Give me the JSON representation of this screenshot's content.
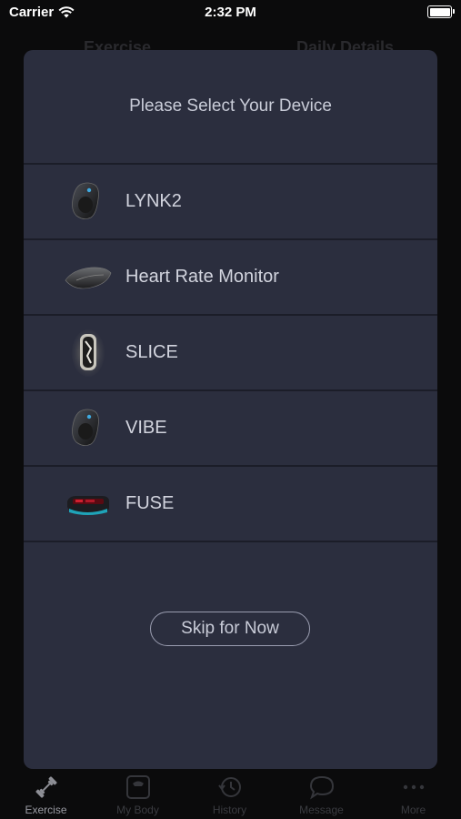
{
  "status_bar": {
    "carrier": "Carrier",
    "time": "2:32 PM"
  },
  "background_header": {
    "left_tab": "Exercise",
    "right_tab": "Daily Details"
  },
  "modal": {
    "title": "Please Select Your Device",
    "devices": [
      {
        "label": "LYNK2",
        "icon": "lynk2-device-icon"
      },
      {
        "label": "Heart Rate Monitor",
        "icon": "heart-rate-monitor-icon"
      },
      {
        "label": "SLICE",
        "icon": "slice-device-icon"
      },
      {
        "label": "VIBE",
        "icon": "vibe-device-icon"
      },
      {
        "label": "FUSE",
        "icon": "fuse-device-icon"
      }
    ],
    "skip_label": "Skip for Now"
  },
  "tab_bar": {
    "tabs": [
      {
        "label": "Exercise",
        "icon": "dumbbell-icon",
        "active": true
      },
      {
        "label": "My Body",
        "icon": "scale-icon",
        "active": false
      },
      {
        "label": "History",
        "icon": "history-clock-icon",
        "active": false
      },
      {
        "label": "Message",
        "icon": "chat-bubble-icon",
        "active": false
      },
      {
        "label": "More",
        "icon": "more-dots-icon",
        "active": false
      }
    ]
  },
  "colors": {
    "modal_bg": "#2b2e3e",
    "divider": "#1b1d28",
    "text": "#d2d4de"
  }
}
